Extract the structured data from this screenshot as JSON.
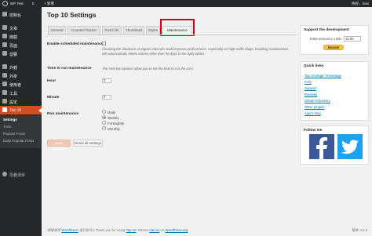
{
  "adminbar": {
    "site_name": "WP Test",
    "comments_count": "0",
    "new_label": "+ 新增",
    "user_label": "你好，max"
  },
  "sidebar": {
    "items": [
      {
        "label": "控制台",
        "icon": "dashboard-icon"
      },
      {
        "label": "文章",
        "icon": "pin-icon"
      },
      {
        "label": "媒體",
        "icon": "media-icon"
      },
      {
        "label": "頁面",
        "icon": "page-icon"
      },
      {
        "label": "迴響",
        "icon": "comments-icon"
      },
      {
        "label": "外觀",
        "icon": "appearance-icon"
      },
      {
        "label": "外掛",
        "icon": "plugins-icon"
      },
      {
        "label": "使用者",
        "icon": "users-icon"
      },
      {
        "label": "工具",
        "icon": "tools-icon"
      },
      {
        "label": "設定",
        "icon": "settings-icon"
      },
      {
        "label": "Top 10",
        "icon": "chart-icon"
      }
    ],
    "submenu": [
      "Settings",
      "Tools",
      "Popular Posts",
      "Daily Popular Posts"
    ],
    "collapse_label": "摺疊選單"
  },
  "page": {
    "title": "Top 10 Settings",
    "tabs": [
      "General",
      "Counter/Tracker",
      "Posts list",
      "Thumbnail",
      "Styles",
      "Maintenance"
    ],
    "active_tab": "Maintenance"
  },
  "form": {
    "enable_label": "Enable scheduled maintenance",
    "enable_desc": "Cleaning the database at regular intervals could improve performance, especially on high traffic blogs. Enabling maintenance will automatically delete entries older than 90 days in the daily tables.",
    "time_label": "Time to run maintenance",
    "time_desc": "The next two options allow you to set the time to run the cron.",
    "hour_label": "Hour",
    "hour_value": "0",
    "minute_label": "Minute",
    "minute_value": "0",
    "run_label": "Run maintenance",
    "run_options": [
      "Daily",
      "Weekly",
      "Fortnightly",
      "Monthly"
    ],
    "run_selected": "Weekly",
    "save_label": "Save Changes",
    "reset_label": "Reset all settings"
  },
  "support": {
    "title": "Support the development",
    "amount_label": "Enter amount in USD:",
    "amount_value": "15.00",
    "donate_label": "Donate"
  },
  "quicklinks": {
    "title": "Quick links",
    "links": [
      "Top 10 plugin homepage",
      "FAQ",
      "Support",
      "Reviews",
      "Github repository",
      "Other plugins",
      "Ajay's blog"
    ]
  },
  "follow": {
    "title": "Follow me",
    "icons": [
      "facebook-icon",
      "twitter-icon"
    ]
  },
  "footer": {
    "left_prefix": "感謝使用",
    "left_wp": "WordPress",
    "left_mid": "進行創作 | Thank you for using",
    "left_top10": "Top 10",
    "left_mid2": ". Please",
    "left_rate": "rate us",
    "left_on": "on",
    "left_wporg": "WordPress.org",
    "right": "版本 4.5.3"
  },
  "colors": {
    "sidebar_bg": "#23282d",
    "accent": "#d54e21",
    "highlight_box": "#d0021b",
    "link": "#0073aa",
    "facebook": "#3b5998",
    "twitter": "#1da1f2"
  }
}
